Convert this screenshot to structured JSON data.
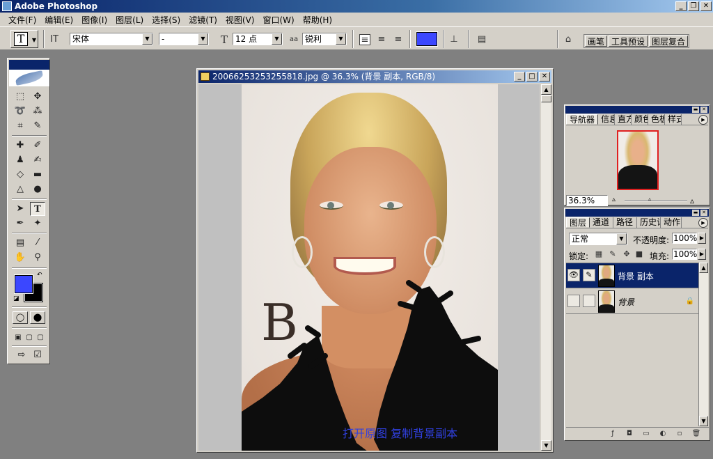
{
  "app": {
    "title": "Adobe Photoshop"
  },
  "menu": [
    "文件(F)",
    "编辑(E)",
    "图像(I)",
    "图层(L)",
    "选择(S)",
    "滤镜(T)",
    "视图(V)",
    "窗口(W)",
    "帮助(H)"
  ],
  "options": {
    "tool_glyph": "T",
    "font_family": "宋体",
    "font_style": "-",
    "font_size": "12 点",
    "antialias": "锐利",
    "text_color": "#3b47ff",
    "palette_well_tabs": [
      "画笔",
      "工具预设",
      "图层复合"
    ]
  },
  "toolbox": {
    "fg_color": "#3b47ff",
    "bg_color": "#000000",
    "type_tool": "T"
  },
  "document": {
    "title": "20066253253255818.jpg @ 36.3% (背景 副本, RGB/8)",
    "caption": "打开原图  复制背景副本",
    "bg_text": "B"
  },
  "navigator": {
    "tabs": [
      "导航器",
      "信息",
      "直方图",
      "颜色",
      "色板",
      "样式"
    ],
    "zoom": "36.3%"
  },
  "layers_panel": {
    "tabs": [
      "图层",
      "通道",
      "路径",
      "历史记录",
      "动作"
    ],
    "blend_mode": "正常",
    "opacity_label": "不透明度:",
    "opacity": "100%",
    "lock_label": "锁定:",
    "fill_label": "填充:",
    "fill": "100%",
    "layers": [
      {
        "name": "背景 副本",
        "selected": true,
        "visible": true
      },
      {
        "name": "背景",
        "selected": false,
        "visible": false,
        "locked": true
      }
    ]
  }
}
